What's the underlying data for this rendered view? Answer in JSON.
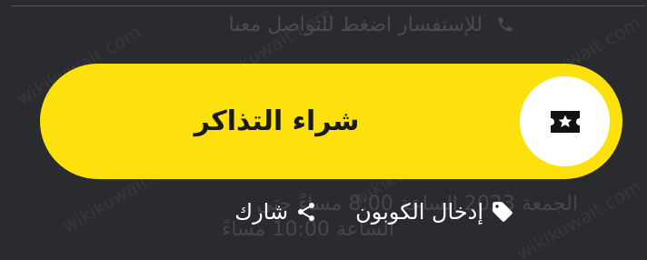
{
  "contact": {
    "text": "للإستفسار اضغط للتواصل معنا",
    "icon": "phone-icon"
  },
  "buy_button": {
    "label": "شراء التذاكر",
    "icon": "ticket-icon",
    "color": "#fde10c"
  },
  "background_info": {
    "line1": "الجمعة 2023 الساعة 8:00 مساءً حتى",
    "line2": "الساعة 10:00 مساءً"
  },
  "actions": {
    "coupon_label": "إدخال الكوبون",
    "coupon_icon": "tag-icon",
    "share_label": "شارك",
    "share_icon": "share-icon"
  },
  "watermark_text": "wikikuwait.com"
}
